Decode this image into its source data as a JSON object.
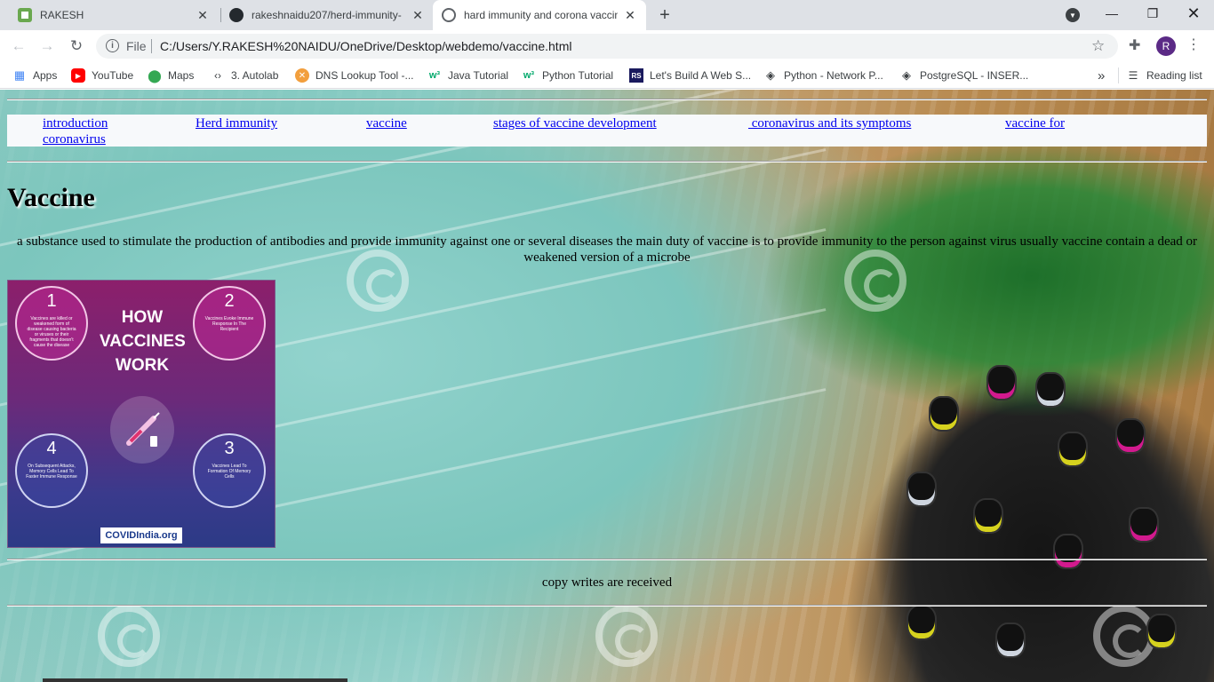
{
  "browser": {
    "tabs": [
      {
        "title": "RAKESH",
        "icon": "sheet-icon",
        "active": false
      },
      {
        "title": "rakeshnaidu207/herd-immunity-",
        "icon": "github-icon",
        "active": false
      },
      {
        "title": "hard immunity and corona vaccin",
        "icon": "globe-icon",
        "active": true
      }
    ],
    "address": {
      "scheme": "File",
      "url": "C:/Users/Y.RAKESH%20NAIDU/OneDrive/Desktop/webdemo/vaccine.html"
    },
    "profile_initial": "R",
    "bookmarks": [
      {
        "label": "Apps",
        "icon": "apps-grid-icon"
      },
      {
        "label": "YouTube",
        "icon": "youtube-icon"
      },
      {
        "label": "Maps",
        "icon": "maps-pin-icon"
      },
      {
        "label": "3. Autolab",
        "icon": "code-brackets-icon"
      },
      {
        "label": "DNS Lookup Tool -...",
        "icon": "dns-tool-icon"
      },
      {
        "label": "Java Tutorial",
        "icon": "w3schools-icon"
      },
      {
        "label": "Python Tutorial",
        "icon": "w3schools-icon"
      },
      {
        "label": "Let's Build A Web S...",
        "icon": "rs-icon"
      },
      {
        "label": "Python - Network P...",
        "icon": "diamond-icon"
      },
      {
        "label": "PostgreSQL - INSER...",
        "icon": "diamond-icon"
      }
    ],
    "overflow_label": "»",
    "reading_list_label": "Reading list"
  },
  "page": {
    "nav": [
      {
        "label": "introduction"
      },
      {
        "label": "Herd immunity"
      },
      {
        "label": "vaccine"
      },
      {
        "label": "stages of vaccine development"
      },
      {
        "label": " coronavirus and its symptoms"
      },
      {
        "label": "vaccine for"
      },
      {
        "label": "coronavirus"
      }
    ],
    "heading": "Vaccine",
    "paragraph": "a substance used to stimulate the production of antibodies and provide immunity against one or several diseases the main duty of vaccine is to provide immunity to the person against virus usually vaccine contain a dead or weakened version of a microbe",
    "infographic": {
      "title_lines": [
        "HOW",
        "VACCINES",
        "WORK"
      ],
      "steps": [
        {
          "num": "1",
          "text": "Vaccines are killed or weakened form of disease causing bacteria or viruses or their fragments that doesn't cause the disease"
        },
        {
          "num": "2",
          "text": "Vaccines Evoke Immune Response In The Recipient"
        },
        {
          "num": "3",
          "text": "Vaccines Lead To Formation Of Memory Cells"
        },
        {
          "num": "4",
          "text": "On Subsequent Attacks, Memory Cells Lead To Faster Immune Response"
        }
      ],
      "footer": "COVIDIndia.org"
    },
    "footer": "copy writes are received",
    "colors": {
      "link": "#0000ee",
      "nav_bg": "#f7f9fb"
    }
  }
}
